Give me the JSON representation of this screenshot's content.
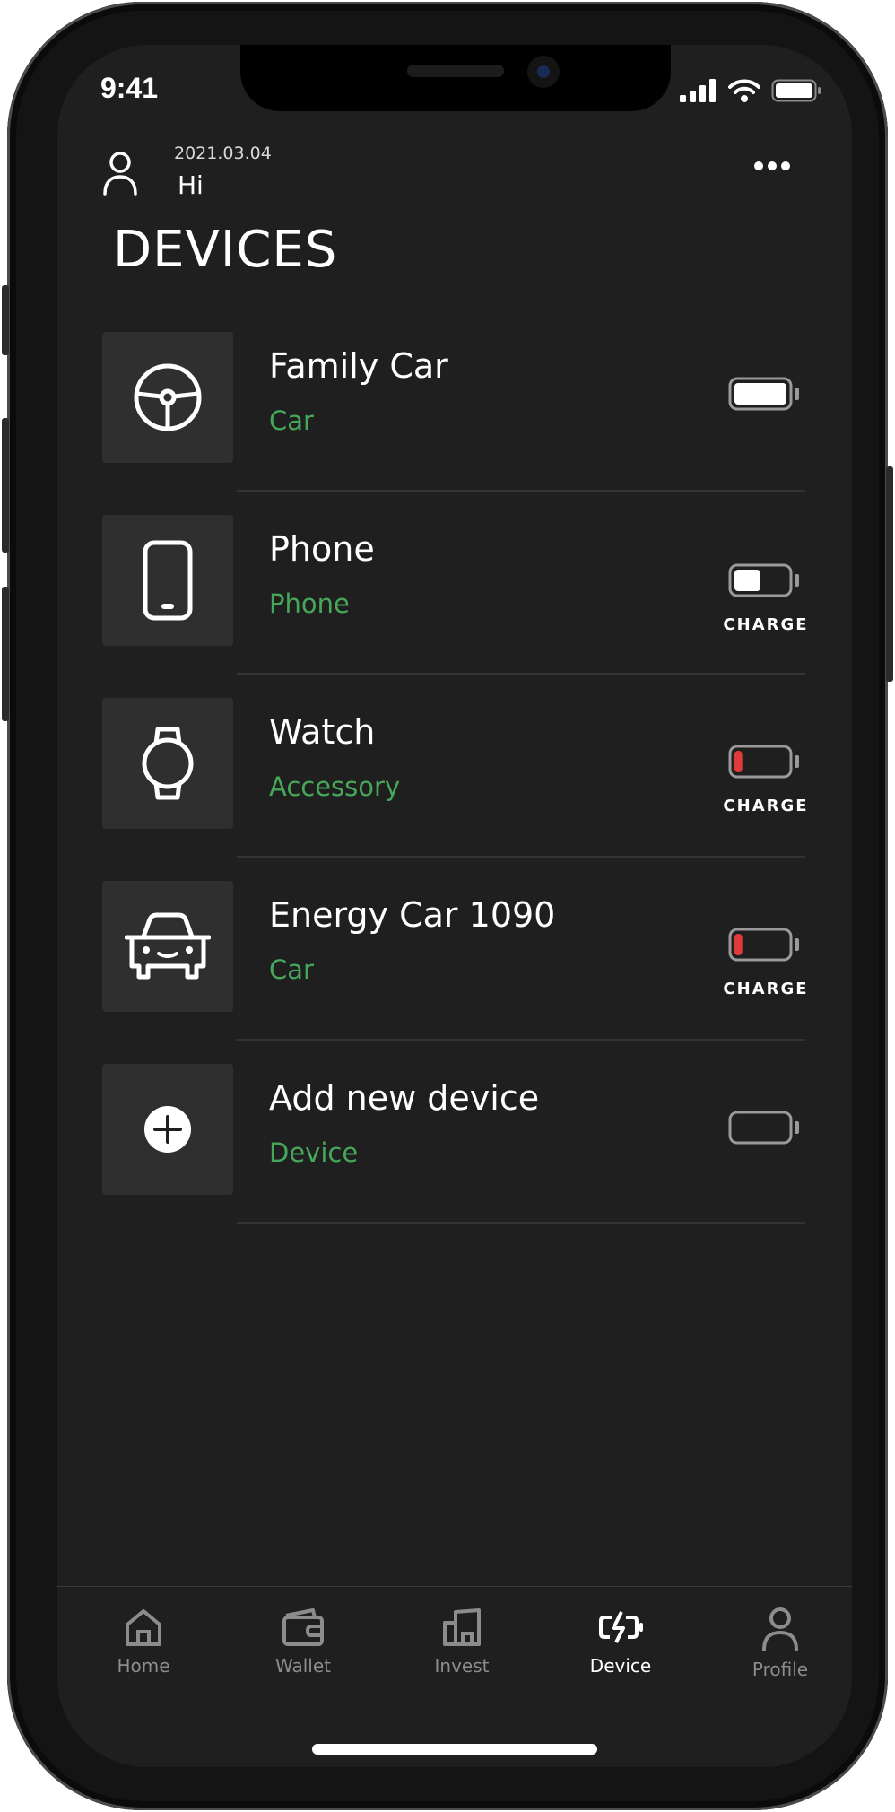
{
  "status_bar": {
    "time": "9:41"
  },
  "header": {
    "date": "2021.03.04",
    "greeting": "Hi"
  },
  "page": {
    "title": "DEVICES"
  },
  "devices": [
    {
      "name": "Family Car",
      "type": "Car",
      "icon": "steering-wheel-icon",
      "battery_level": 1.0,
      "battery_color": "#ffffff",
      "charge_label": ""
    },
    {
      "name": "Phone",
      "type": "Phone",
      "icon": "smartphone-icon",
      "battery_level": 0.5,
      "battery_color": "#ffffff",
      "charge_label": "CHARGE"
    },
    {
      "name": "Watch",
      "type": "Accessory",
      "icon": "watch-icon",
      "battery_level": 0.15,
      "battery_color": "#e03b3b",
      "charge_label": "CHARGE"
    },
    {
      "name": "Energy Car 1090",
      "type": "Car",
      "icon": "car-front-icon",
      "battery_level": 0.15,
      "battery_color": "#e03b3b",
      "charge_label": "CHARGE"
    },
    {
      "name": "Add new device",
      "type": "Device",
      "icon": "plus-circle-icon",
      "battery_level": 0,
      "battery_color": "#ffffff",
      "charge_label": ""
    }
  ],
  "tabs": [
    {
      "label": "Home",
      "icon": "home-icon",
      "active": false
    },
    {
      "label": "Wallet",
      "icon": "wallet-icon",
      "active": false
    },
    {
      "label": "Invest",
      "icon": "building-icon",
      "active": false
    },
    {
      "label": "Device",
      "icon": "battery-charging-icon",
      "active": true
    },
    {
      "label": "Profile",
      "icon": "user-icon",
      "active": false
    }
  ],
  "colors": {
    "background": "#1f1f1f",
    "tile": "#2f2f2f",
    "accent_green": "#46a75a",
    "battery_low": "#e03b3b"
  }
}
